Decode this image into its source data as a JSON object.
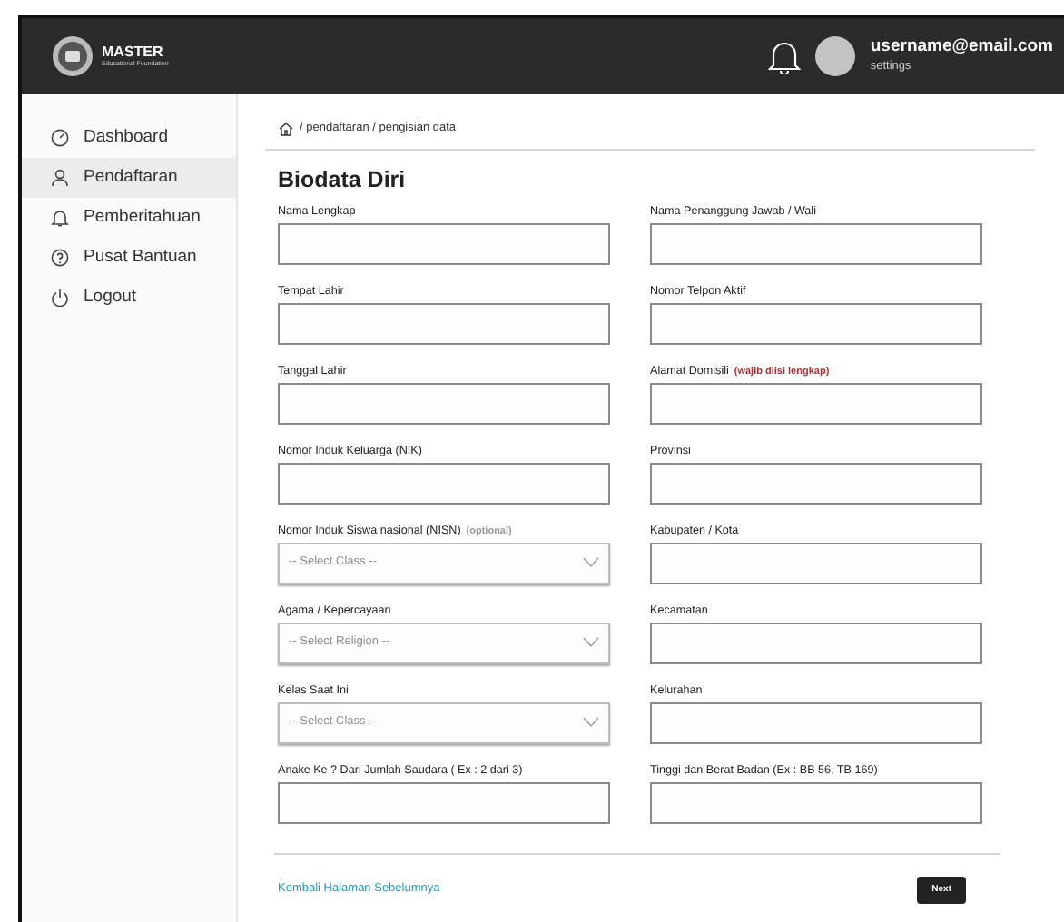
{
  "header": {
    "logo_title": "MASTER",
    "logo_subtitle": "Educational Foundation",
    "user_email": "username@email.com",
    "user_link": "settings"
  },
  "sidebar": {
    "items": [
      {
        "label": "Dashboard",
        "selected": false
      },
      {
        "label": "Pendaftaran",
        "selected": true
      },
      {
        "label": "Pemberitahuan",
        "selected": false
      },
      {
        "label": "Pusat Bantuan",
        "selected": false
      },
      {
        "label": "Logout",
        "selected": false
      }
    ]
  },
  "breadcrumb": "/ pendaftaran / pengisian data",
  "title": "Biodata Diri",
  "form_rows": [
    {
      "left": {
        "label": "Nama Lengkap",
        "kind": "text"
      },
      "right": {
        "label": "Nama Penanggung Jawab  / Wali",
        "kind": "text"
      }
    },
    {
      "left": {
        "label": "Tempat Lahir",
        "kind": "text"
      },
      "right": {
        "label": "Nomor Telpon Aktif",
        "kind": "text"
      }
    },
    {
      "left": {
        "label": "Tanggal Lahir",
        "kind": "text"
      },
      "right": {
        "label": "Alamat Domisili",
        "note": {
          "text": "(wajib diisi lengkap)",
          "color": "#b03030"
        },
        "kind": "text"
      }
    },
    {
      "left": {
        "label": "Nomor Induk Keluarga (NIK)",
        "kind": "text"
      },
      "right": {
        "label": "Provinsi",
        "kind": "text"
      }
    },
    {
      "left": {
        "label": "Nomor Induk Siswa nasional (NISN)",
        "note": {
          "text": "(optional)",
          "color": "#999999"
        },
        "kind": "select",
        "placeholder": "-- Select Class --"
      },
      "right": {
        "label": "Kabupaten / Kota",
        "kind": "text"
      }
    },
    {
      "left": {
        "label": "Agama / Kepercayaan",
        "kind": "select",
        "placeholder": "-- Select Religion --"
      },
      "right": {
        "label": "Kecamatan",
        "kind": "text"
      }
    },
    {
      "left": {
        "label": "Kelas Saat Ini",
        "kind": "select",
        "placeholder": "-- Select Class --"
      },
      "right": {
        "label": "Kelurahan",
        "kind": "text"
      }
    },
    {
      "left": {
        "label": "Anake Ke ?  Dari Jumlah Saudara ( Ex : 2 dari 3)",
        "kind": "text"
      },
      "right": {
        "label": "Tinggi dan Berat Badan (Ex : BB 56, TB 169)",
        "kind": "text"
      }
    }
  ],
  "footer": {
    "back_link": "Kembali Halaman Sebelumnya",
    "next_button": "Next"
  }
}
